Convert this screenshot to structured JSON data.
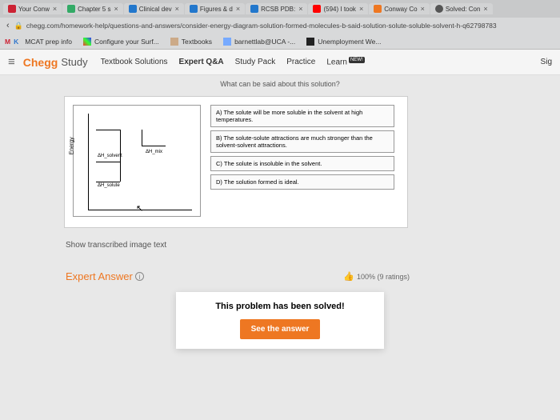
{
  "tabs": [
    {
      "label": "Your Conw",
      "fav": "fav-red"
    },
    {
      "label": "Chapter 5 s",
      "fav": "fav-green"
    },
    {
      "label": "Clinical dev",
      "fav": "fav-blue"
    },
    {
      "label": "Figures & d",
      "fav": "fav-blue"
    },
    {
      "label": "RCSB PDB:",
      "fav": "fav-blue"
    },
    {
      "label": "(594) I took",
      "fav": "fav-yt"
    },
    {
      "label": "Conway Co",
      "fav": "fav-orange"
    },
    {
      "label": "Solved: Con",
      "fav": "fav-reload"
    }
  ],
  "url": "chegg.com/homework-help/questions-and-answers/consider-energy-diagram-solution-formed-molecules-b-said-solution-solute-soluble-solvent-h-q62798783",
  "bookmarks": [
    {
      "label": "MCAT prep info",
      "icon": "bi-m"
    },
    {
      "label": "Configure your Surf...",
      "icon": "bi-conf"
    },
    {
      "label": "Textbooks",
      "icon": "bi-text"
    },
    {
      "label": "barnettlab@UCA -...",
      "icon": "bi-folder"
    },
    {
      "label": "Unemployment We...",
      "icon": "bi-fv"
    }
  ],
  "nav": {
    "logo": "Chegg",
    "logoSub": "Study",
    "items": [
      "Textbook Solutions",
      "Expert Q&A",
      "Study Pack",
      "Practice",
      "Learn"
    ],
    "newBadge": "NEW!",
    "right": "Sig"
  },
  "subtitle": "What can be said about this solution?",
  "diagram": {
    "ylabel": "Energy",
    "h1": "ΔH_solvent",
    "h2": "ΔH_mix",
    "h3": "ΔH_solute"
  },
  "options": [
    "A) The solute will be more soluble in the solvent at high temperatures.",
    "B) The solute-solute attractions are much stronger than the solvent-solvent attractions.",
    "C) The solute is insoluble in the solvent.",
    "D) The solution formed is ideal."
  ],
  "transcribed": "Show transcribed image text",
  "answer": {
    "heading": "Expert Answer",
    "ratings": "100% (9 ratings)"
  },
  "solved": {
    "text": "This problem has been solved!",
    "button": "See the answer"
  }
}
